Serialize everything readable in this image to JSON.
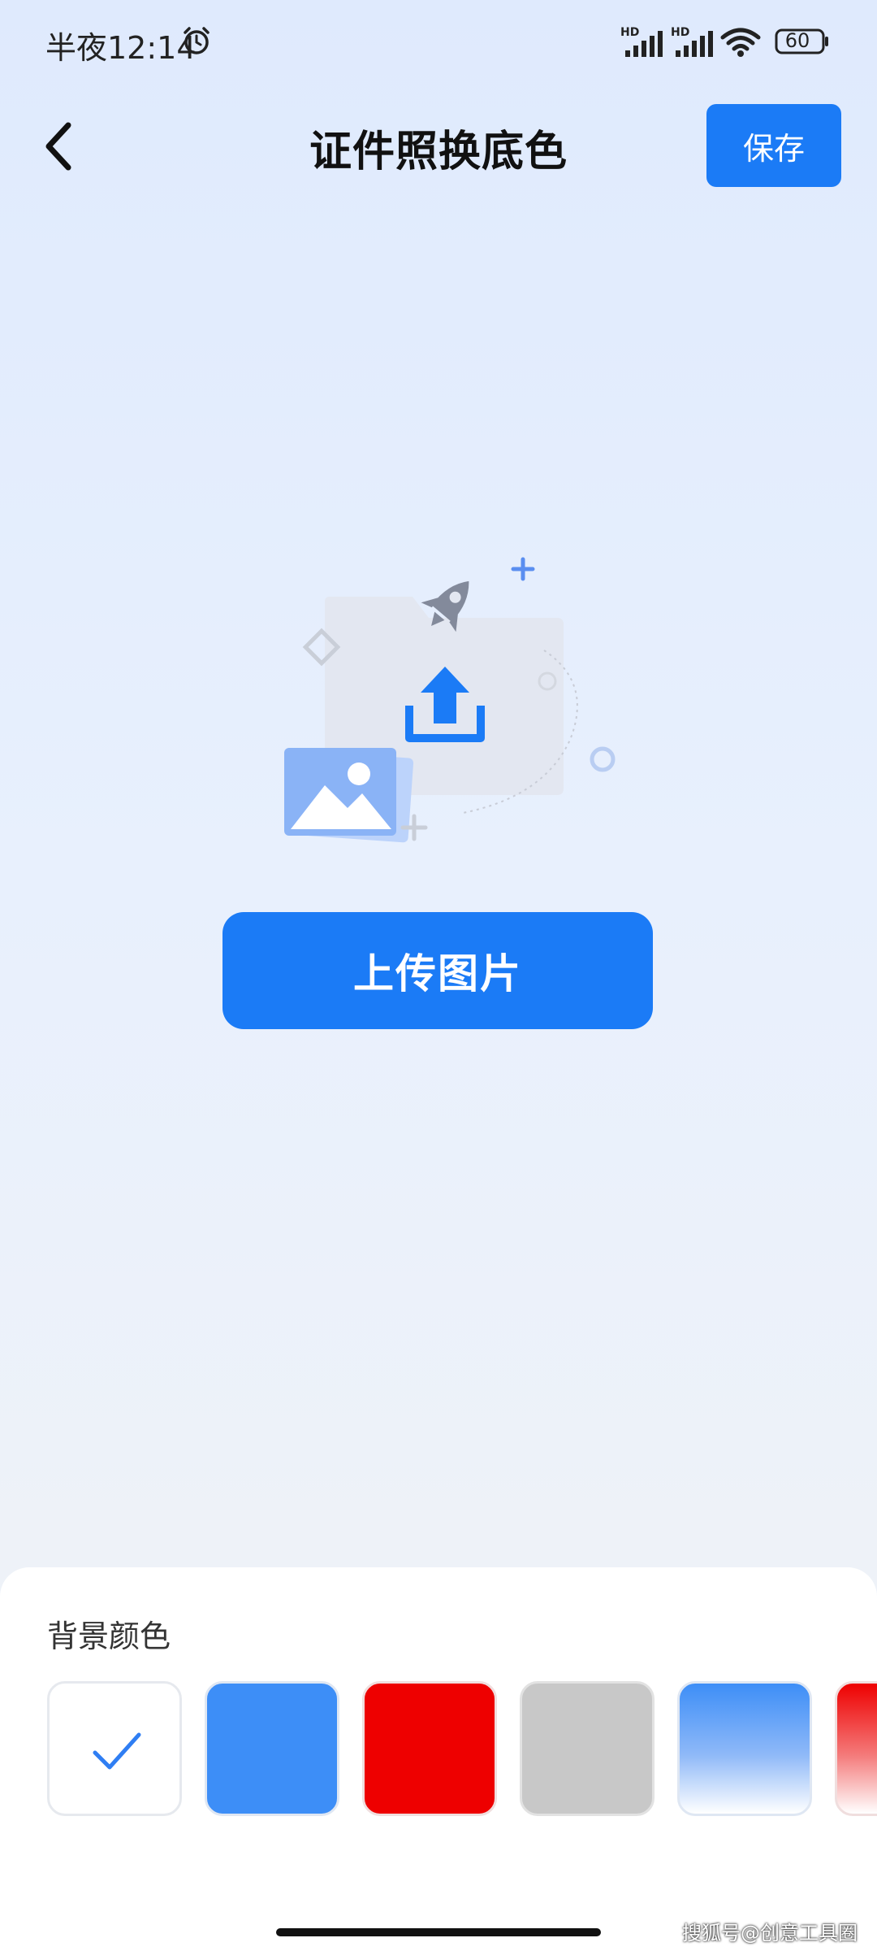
{
  "status_bar": {
    "time": "半夜12:14",
    "signal_label_1": "HD",
    "signal_label_2": "HD",
    "battery_level": "60",
    "icons": [
      "alarm-icon",
      "signal-icon",
      "signal-icon",
      "wifi-icon",
      "battery-icon"
    ]
  },
  "header": {
    "title": "证件照换底色",
    "save_label": "保存",
    "back_icon": "chevron-left-icon"
  },
  "main": {
    "upload_label": "上传图片",
    "illustration_icon": "upload-folder-illustration"
  },
  "panel": {
    "title": "背景颜色",
    "swatches": [
      {
        "name": "white",
        "color": "#ffffff",
        "selected": true
      },
      {
        "name": "blue",
        "color": "#3d8ef7",
        "selected": false
      },
      {
        "name": "red",
        "color": "#ee0000",
        "selected": false
      },
      {
        "name": "gray",
        "color": "#c8c8c8",
        "selected": false
      },
      {
        "name": "blue-gradient",
        "color": "#3d8ef7",
        "selected": false
      },
      {
        "name": "red-gradient",
        "color": "#ee0000",
        "selected": false
      }
    ]
  },
  "watermark": "搜狐号@创意工具圈",
  "colors": {
    "accent": "#1b7bf6",
    "background_top": "#dfeafd",
    "background_bottom": "#eef2f8"
  }
}
